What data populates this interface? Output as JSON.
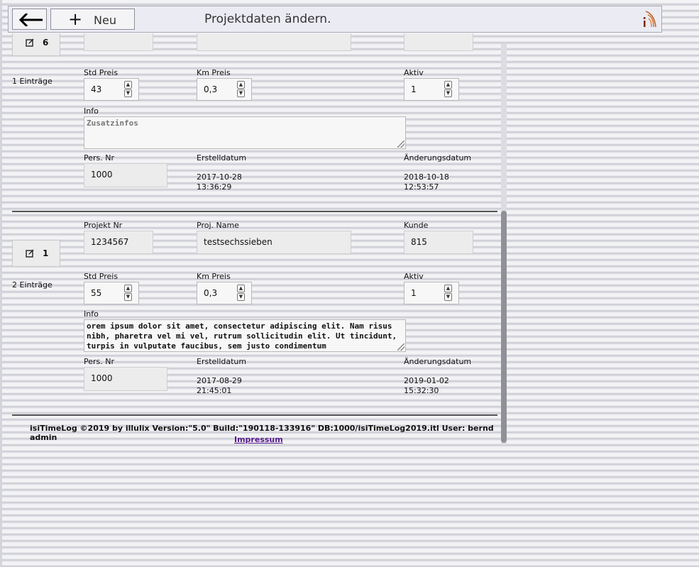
{
  "header": {
    "title": "Projektdaten ändern.",
    "new_label": "Neu",
    "back_icon": "arrow-left-icon",
    "new_icon": "plus-icon",
    "logo_icon": "illulix-logo"
  },
  "labels": {
    "projekt_nr": "Projekt Nr",
    "proj_name": "Proj. Name",
    "kunde": "Kunde",
    "std_preis": "Std Preis",
    "km_preis": "Km Preis",
    "aktiv": "Aktiv",
    "info": "Info",
    "pers_nr": "Pers. Nr",
    "erstelldatum": "Erstelldatum",
    "aenderungsdatum": "Änderungsdatum"
  },
  "records": [
    {
      "edit_number": "6",
      "entries": "1 Einträge",
      "std_preis": "43",
      "km_preis": "0,3",
      "aktiv": "1",
      "info_placeholder": "Zusatzinfos",
      "pers_nr": "1000",
      "erstell_date": "2017-10-28",
      "erstell_time": "13:36:29",
      "aender_date": "2018-10-18",
      "aender_time": "12:53:57"
    },
    {
      "edit_number": "1",
      "entries": "2 Einträge",
      "projekt_nr": "1234567",
      "proj_name": "testsechssieben",
      "kunde": "815",
      "std_preis": "55",
      "km_preis": "0,3",
      "aktiv": "1",
      "info": "orem ipsum dolor sit amet, consectetur adipiscing elit. Nam risus nibh, pharetra vel mi vel, rutrum sollicitudin elit. Ut tincidunt, turpis in vulputate faucibus, sem justo condimentum",
      "pers_nr": "1000",
      "erstell_date": "2017-08-29",
      "erstell_time": "21:45:01",
      "aender_date": "2019-01-02",
      "aender_time": "15:32:30"
    }
  ],
  "footer": {
    "text": "isiTimeLog ©2019 by illulix Version:\"5.0\" Build:\"190118-133916\" DB:1000/isiTimeLog2019.itl User: bernd admin",
    "impressum": "Impressum"
  }
}
